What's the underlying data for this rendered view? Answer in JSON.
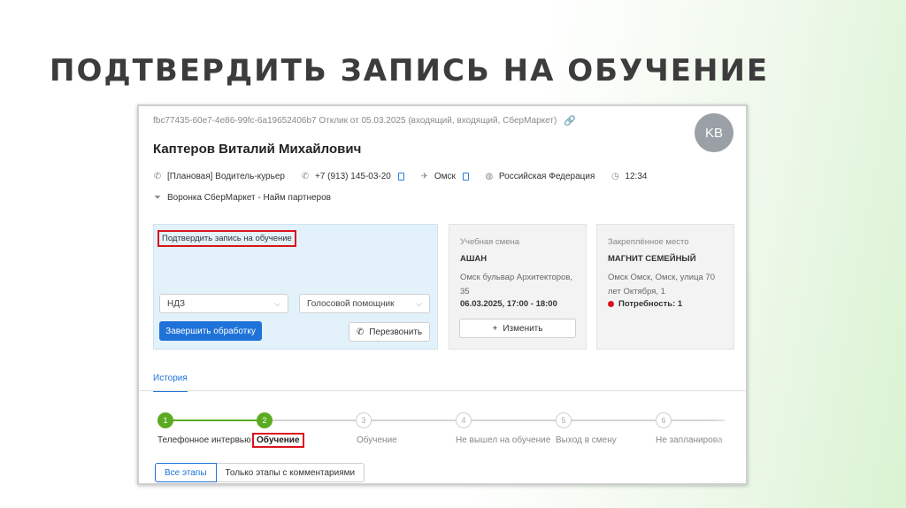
{
  "slide": {
    "title": "ПОДТВЕРДИТЬ ЗАПИСЬ НА ОБУЧЕНИЕ"
  },
  "ticket": {
    "id_line": "fbc77435-60e7-4e86-99fc-6a19652406b7 Отклик от 05.03.2025 (входящий, входящий, СберМаркет)",
    "link_icon": "link-icon"
  },
  "avatar": {
    "initials": "KB"
  },
  "person": {
    "name": "Каптеров Виталий Михайлович",
    "vacancy": "[Плановая] Водитель-курьер",
    "phone": "+7 (913) 145-03-20",
    "city": "Омск",
    "country": "Российская Федерация",
    "time": "12:34",
    "funnel": "Воронка СберМаркет - Найм партнеров"
  },
  "action_panel": {
    "label": "Подтвердить запись на обучение",
    "select_1": "НДЗ",
    "select_2": "Голосовой помощник",
    "finish_button": "Завершить обработку",
    "call_button": "Перезвонить"
  },
  "shift_card": {
    "caption": "Учебная смена",
    "name": "АШАН",
    "address": "Омск бульвар Архитекторов, 35",
    "datetime": "06.03.2025, 17:00 - 18:00",
    "change_button": "Изменить"
  },
  "place_card": {
    "caption": "Закреплённое место",
    "name": "МАГНИТ СЕМЕЙНЫЙ",
    "address": "Омск Омск, Омск, улица 70 лет Октября, 1",
    "need": "Потребность: 1"
  },
  "tabs": {
    "history": "История"
  },
  "stepper": {
    "steps": [
      {
        "num": "1",
        "label": "Телефонное интервью",
        "state": "done"
      },
      {
        "num": "2",
        "label": "Обучение",
        "state": "done"
      },
      {
        "num": "3",
        "label": "Обучение",
        "state": "todo"
      },
      {
        "num": "4",
        "label": "Не вышел на обучение",
        "state": "todo"
      },
      {
        "num": "5",
        "label": "Выход в смену",
        "state": "todo"
      },
      {
        "num": "6",
        "label": "Не запланирова",
        "state": "todo"
      }
    ]
  },
  "filters": {
    "all": "Все этапы",
    "comments_only": "Только этапы с комментариями"
  },
  "colors": {
    "accent": "#1f72d8",
    "success": "#5bab22",
    "highlight": "#d9141e"
  }
}
